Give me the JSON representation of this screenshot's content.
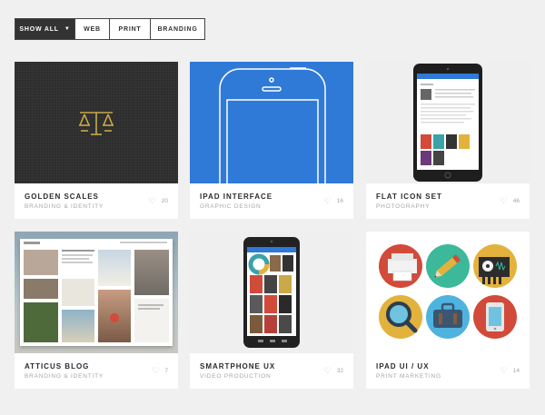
{
  "filters": [
    {
      "label": "SHOW ALL",
      "active": true,
      "dropdown": true
    },
    {
      "label": "WEB",
      "active": false
    },
    {
      "label": "PRINT",
      "active": false
    },
    {
      "label": "BRANDING",
      "active": false
    }
  ],
  "cards": [
    {
      "title": "GOLDEN SCALES",
      "category": "BRANDING & IDENTITY",
      "likes": "20",
      "thumbnail_icon": "golden-scales-logo"
    },
    {
      "title": "IPAD INTERFACE",
      "category": "GRAPHIC DESIGN",
      "likes": "16",
      "thumbnail_icon": "phone-outline"
    },
    {
      "title": "FLAT ICON SET",
      "category": "PHOTOGRAPHY",
      "likes": "46",
      "thumbnail_icon": "ipad-mockup"
    },
    {
      "title": "ATTICUS BLOG",
      "category": "BRANDING & IDENTITY",
      "likes": "7",
      "thumbnail_icon": "blog-mockup"
    },
    {
      "title": "SMARTPHONE UX",
      "category": "VIDEO PRODUCTION",
      "likes": "32",
      "thumbnail_icon": "android-phone-mockup"
    },
    {
      "title": "IPAD UI / UX",
      "category": "PRINT MARKETING",
      "likes": "14",
      "thumbnail_icon": "flat-icons-grid"
    }
  ],
  "colors": {
    "active_filter_bg": "#333333",
    "page_bg": "#f0f0f0",
    "gold": "#c9a94a",
    "blue": "#2f79d7"
  }
}
